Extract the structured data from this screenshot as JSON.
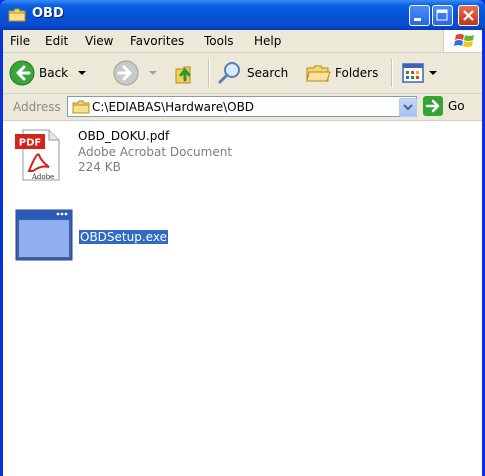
{
  "window": {
    "title": "OBD"
  },
  "menu": [
    "File",
    "Edit",
    "View",
    "Favorites",
    "Tools",
    "Help"
  ],
  "toolbar": {
    "back_label": "Back",
    "search_label": "Search",
    "folders_label": "Folders"
  },
  "address": {
    "label": "Address",
    "path": "C:\\EDIABAS\\Hardware\\OBD",
    "go_label": "Go"
  },
  "files": [
    {
      "name": "OBD_DOKU.pdf",
      "type": "Adobe Acrobat Document",
      "size": "224 KB",
      "icon": "pdf-file-icon",
      "icon_text": "PDF",
      "icon_brand": "Adobe"
    },
    {
      "name": "OBDSetup.exe",
      "icon": "application-window-icon",
      "selected": true
    }
  ],
  "colors": {
    "title_bar": "#0453d6",
    "selection": "#316ac5",
    "close_button": "#c2351a"
  }
}
